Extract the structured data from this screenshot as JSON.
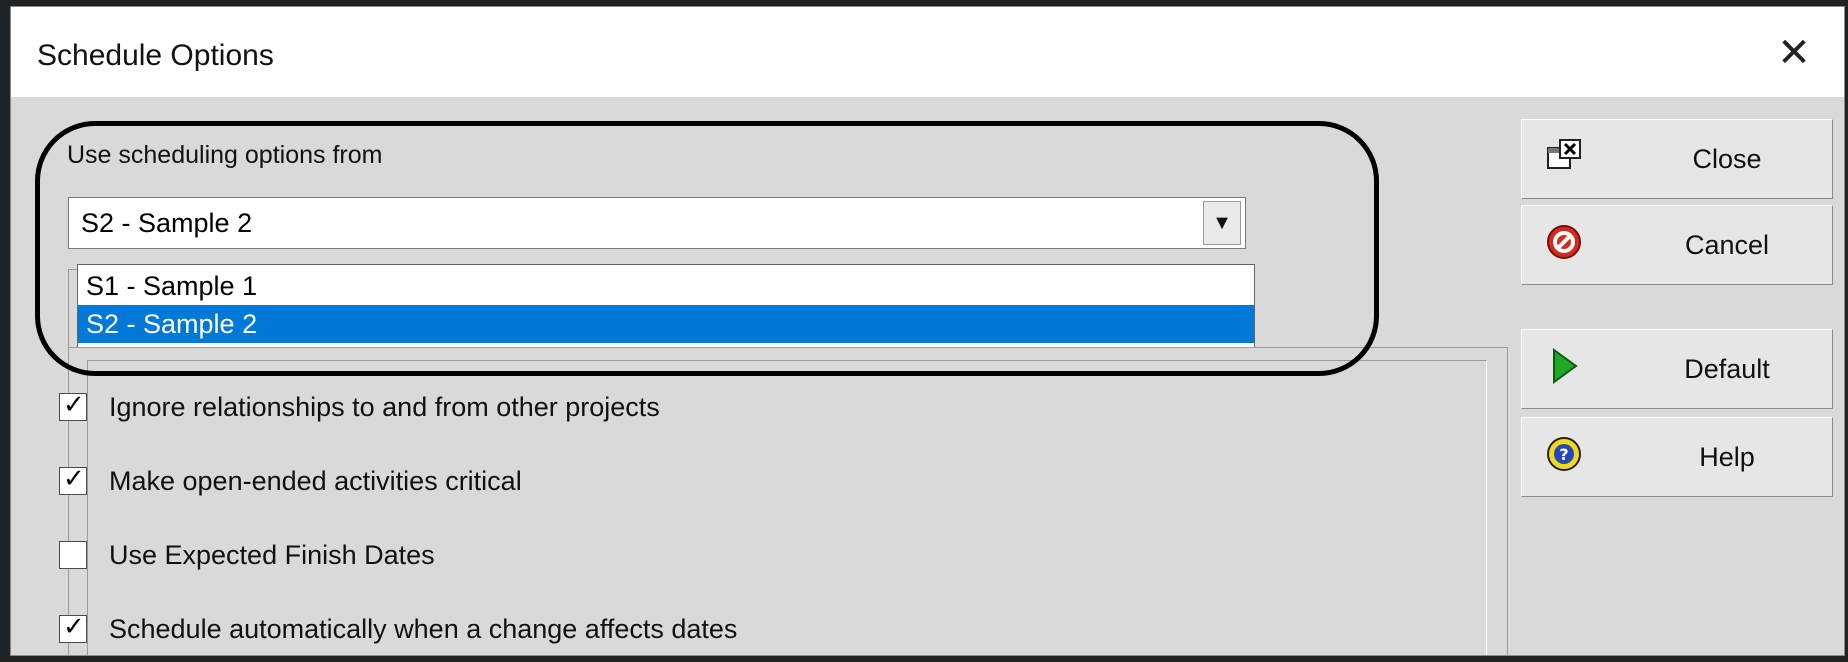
{
  "window": {
    "title": "Schedule Options",
    "close_glyph": "✕"
  },
  "source": {
    "label": "Use scheduling options from",
    "selected": "S2 - Sample 2",
    "arrow_glyph": "▼",
    "options": [
      {
        "label": "S1 - Sample 1",
        "selected": false
      },
      {
        "label": "S2 - Sample 2",
        "selected": true
      }
    ]
  },
  "options": [
    {
      "label": "Ignore relationships to and from other projects",
      "checked": true
    },
    {
      "label": "Make open-ended activities critical",
      "checked": true
    },
    {
      "label": "Use Expected Finish Dates",
      "checked": false
    },
    {
      "label": "Schedule automatically when a change affects dates",
      "checked": true
    }
  ],
  "buttons": {
    "close": {
      "label": "Close",
      "icon": "close-window-icon"
    },
    "cancel": {
      "label": "Cancel",
      "icon": "cancel-icon"
    },
    "default": {
      "label": "Default",
      "icon": "play-icon"
    },
    "help": {
      "label": "Help",
      "icon": "help-icon"
    }
  },
  "colors": {
    "selection": "#0078d7",
    "dialog_bg": "#d9d9d9",
    "annotation": "#000000"
  }
}
